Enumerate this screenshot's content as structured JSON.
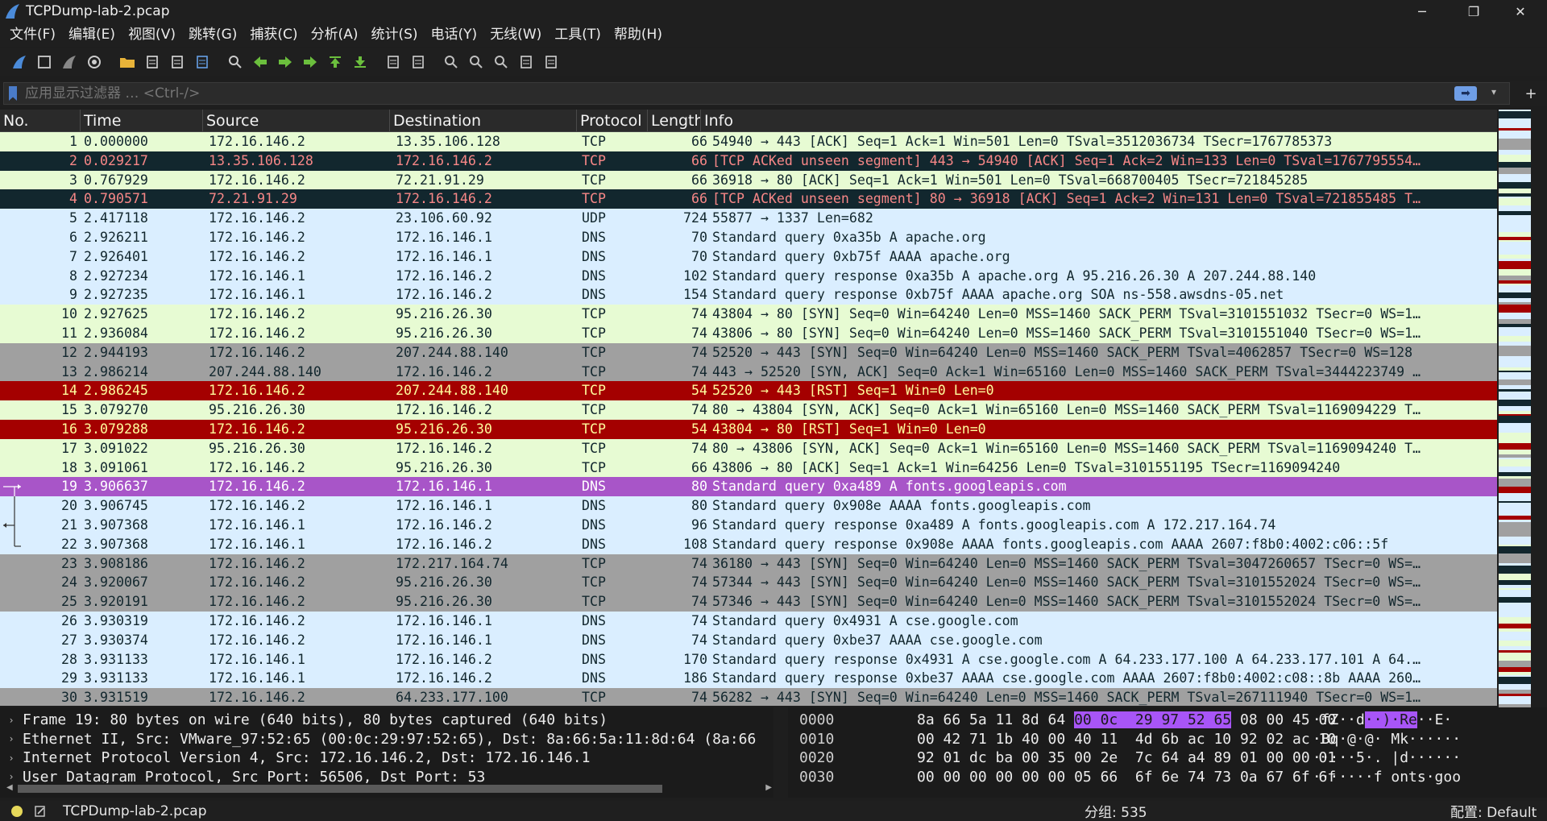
{
  "window": {
    "title": "TCPDump-lab-2.pcap",
    "minimize": "─",
    "restore": "❐",
    "close": "✕"
  },
  "menu": [
    "文件(F)",
    "编辑(E)",
    "视图(V)",
    "跳转(G)",
    "捕获(C)",
    "分析(A)",
    "统计(S)",
    "电话(Y)",
    "无线(W)",
    "工具(T)",
    "帮助(H)"
  ],
  "toolbar": {
    "icons": [
      "shark-fin-icon",
      "stop-square-icon",
      "restart-fin-icon",
      "capture-options-icon",
      "open-folder-icon",
      "file-icon",
      "close-file-icon",
      "reload-icon",
      "find-icon",
      "go-back-icon",
      "go-forward-icon",
      "go-to-packet-icon",
      "first-packet-icon",
      "last-packet-icon",
      "autoscroll-icon",
      "colorize-icon",
      "zoom-in-icon",
      "zoom-out-icon",
      "zoom-normal-icon",
      "resize-columns-icon",
      "layout-icon"
    ]
  },
  "filter": {
    "placeholder": "应用显示过滤器 … <Ctrl-/>",
    "apply": "➡",
    "dropdown": "▾",
    "add": "+"
  },
  "columns": [
    "No.",
    "Time",
    "Source",
    "Destination",
    "Protocol",
    "Length",
    "Info"
  ],
  "colors": {
    "tcp_green": "#e7fbd3",
    "dns_blue": "#daeeff",
    "syn_gray": "#a0a0a0",
    "bad_dark": "#12272e",
    "bad_fg": "#f78787",
    "rst_red": "#a40000",
    "rst_fg": "#fffc9c",
    "selected": "#a855c8",
    "udp_blue": "#daeeff"
  },
  "packets": [
    {
      "no": "1",
      "time": "0.000000",
      "src": "172.16.146.2",
      "dst": "13.35.106.128",
      "proto": "TCP",
      "len": "66",
      "info": "54940 → 443 [ACK] Seq=1 Ack=1 Win=501 Len=0 TSval=3512036734 TSecr=1767785373",
      "style": "tcp"
    },
    {
      "no": "2",
      "time": "0.029217",
      "src": "13.35.106.128",
      "dst": "172.16.146.2",
      "proto": "TCP",
      "len": "66",
      "info": "[TCP ACKed unseen segment] 443 → 54940 [ACK] Seq=1 Ack=2 Win=133 Len=0 TSval=1767795554…",
      "style": "bad"
    },
    {
      "no": "3",
      "time": "0.767929",
      "src": "172.16.146.2",
      "dst": "72.21.91.29",
      "proto": "TCP",
      "len": "66",
      "info": "36918 → 80 [ACK] Seq=1 Ack=1 Win=501 Len=0 TSval=668700405 TSecr=721845285",
      "style": "tcp"
    },
    {
      "no": "4",
      "time": "0.790571",
      "src": "72.21.91.29",
      "dst": "172.16.146.2",
      "proto": "TCP",
      "len": "66",
      "info": "[TCP ACKed unseen segment] 80 → 36918 [ACK] Seq=1 Ack=2 Win=131 Len=0 TSval=721855485 T…",
      "style": "bad"
    },
    {
      "no": "5",
      "time": "2.417118",
      "src": "172.16.146.2",
      "dst": "23.106.60.92",
      "proto": "UDP",
      "len": "724",
      "info": "55877 → 1337 Len=682",
      "style": "dns"
    },
    {
      "no": "6",
      "time": "2.926211",
      "src": "172.16.146.2",
      "dst": "172.16.146.1",
      "proto": "DNS",
      "len": "70",
      "info": "Standard query 0xa35b A apache.org",
      "style": "dns"
    },
    {
      "no": "7",
      "time": "2.926401",
      "src": "172.16.146.2",
      "dst": "172.16.146.1",
      "proto": "DNS",
      "len": "70",
      "info": "Standard query 0xb75f AAAA apache.org",
      "style": "dns"
    },
    {
      "no": "8",
      "time": "2.927234",
      "src": "172.16.146.1",
      "dst": "172.16.146.2",
      "proto": "DNS",
      "len": "102",
      "info": "Standard query response 0xa35b A apache.org A 95.216.26.30 A 207.244.88.140",
      "style": "dns"
    },
    {
      "no": "9",
      "time": "2.927235",
      "src": "172.16.146.1",
      "dst": "172.16.146.2",
      "proto": "DNS",
      "len": "154",
      "info": "Standard query response 0xb75f AAAA apache.org SOA ns-558.awsdns-05.net",
      "style": "dns"
    },
    {
      "no": "10",
      "time": "2.927625",
      "src": "172.16.146.2",
      "dst": "95.216.26.30",
      "proto": "TCP",
      "len": "74",
      "info": "43804 → 80 [SYN] Seq=0 Win=64240 Len=0 MSS=1460 SACK_PERM TSval=3101551032 TSecr=0 WS=1…",
      "style": "tcp"
    },
    {
      "no": "11",
      "time": "2.936084",
      "src": "172.16.146.2",
      "dst": "95.216.26.30",
      "proto": "TCP",
      "len": "74",
      "info": "43806 → 80 [SYN] Seq=0 Win=64240 Len=0 MSS=1460 SACK_PERM TSval=3101551040 TSecr=0 WS=1…",
      "style": "tcp"
    },
    {
      "no": "12",
      "time": "2.944193",
      "src": "172.16.146.2",
      "dst": "207.244.88.140",
      "proto": "TCP",
      "len": "74",
      "info": "52520 → 443 [SYN] Seq=0 Win=64240 Len=0 MSS=1460 SACK_PERM TSval=4062857 TSecr=0 WS=128",
      "style": "syn"
    },
    {
      "no": "13",
      "time": "2.986214",
      "src": "207.244.88.140",
      "dst": "172.16.146.2",
      "proto": "TCP",
      "len": "74",
      "info": "443 → 52520 [SYN, ACK] Seq=0 Ack=1 Win=65160 Len=0 MSS=1460 SACK_PERM TSval=3444223749 …",
      "style": "syn"
    },
    {
      "no": "14",
      "time": "2.986245",
      "src": "172.16.146.2",
      "dst": "207.244.88.140",
      "proto": "TCP",
      "len": "54",
      "info": "52520 → 443 [RST] Seq=1 Win=0 Len=0",
      "style": "rst"
    },
    {
      "no": "15",
      "time": "3.079270",
      "src": "95.216.26.30",
      "dst": "172.16.146.2",
      "proto": "TCP",
      "len": "74",
      "info": "80 → 43804 [SYN, ACK] Seq=0 Ack=1 Win=65160 Len=0 MSS=1460 SACK_PERM TSval=1169094229 T…",
      "style": "tcp"
    },
    {
      "no": "16",
      "time": "3.079288",
      "src": "172.16.146.2",
      "dst": "95.216.26.30",
      "proto": "TCP",
      "len": "54",
      "info": "43804 → 80 [RST] Seq=1 Win=0 Len=0",
      "style": "rst"
    },
    {
      "no": "17",
      "time": "3.091022",
      "src": "95.216.26.30",
      "dst": "172.16.146.2",
      "proto": "TCP",
      "len": "74",
      "info": "80 → 43806 [SYN, ACK] Seq=0 Ack=1 Win=65160 Len=0 MSS=1460 SACK_PERM TSval=1169094240 T…",
      "style": "tcp"
    },
    {
      "no": "18",
      "time": "3.091061",
      "src": "172.16.146.2",
      "dst": "95.216.26.30",
      "proto": "TCP",
      "len": "66",
      "info": "43806 → 80 [ACK] Seq=1 Ack=1 Win=64256 Len=0 TSval=3101551195 TSecr=1169094240",
      "style": "tcp"
    },
    {
      "no": "19",
      "time": "3.906637",
      "src": "172.16.146.2",
      "dst": "172.16.146.1",
      "proto": "DNS",
      "len": "80",
      "info": "Standard query 0xa489 A fonts.googleapis.com",
      "style": "selected"
    },
    {
      "no": "20",
      "time": "3.906745",
      "src": "172.16.146.2",
      "dst": "172.16.146.1",
      "proto": "DNS",
      "len": "80",
      "info": "Standard query 0x908e AAAA fonts.googleapis.com",
      "style": "dns"
    },
    {
      "no": "21",
      "time": "3.907368",
      "src": "172.16.146.1",
      "dst": "172.16.146.2",
      "proto": "DNS",
      "len": "96",
      "info": "Standard query response 0xa489 A fonts.googleapis.com A 172.217.164.74",
      "style": "dns"
    },
    {
      "no": "22",
      "time": "3.907368",
      "src": "172.16.146.1",
      "dst": "172.16.146.2",
      "proto": "DNS",
      "len": "108",
      "info": "Standard query response 0x908e AAAA fonts.googleapis.com AAAA 2607:f8b0:4002:c06::5f",
      "style": "dns"
    },
    {
      "no": "23",
      "time": "3.908186",
      "src": "172.16.146.2",
      "dst": "172.217.164.74",
      "proto": "TCP",
      "len": "74",
      "info": "36180 → 443 [SYN] Seq=0 Win=64240 Len=0 MSS=1460 SACK_PERM TSval=3047260657 TSecr=0 WS=…",
      "style": "syn"
    },
    {
      "no": "24",
      "time": "3.920067",
      "src": "172.16.146.2",
      "dst": "95.216.26.30",
      "proto": "TCP",
      "len": "74",
      "info": "57344 → 443 [SYN] Seq=0 Win=64240 Len=0 MSS=1460 SACK_PERM TSval=3101552024 TSecr=0 WS=…",
      "style": "syn"
    },
    {
      "no": "25",
      "time": "3.920191",
      "src": "172.16.146.2",
      "dst": "95.216.26.30",
      "proto": "TCP",
      "len": "74",
      "info": "57346 → 443 [SYN] Seq=0 Win=64240 Len=0 MSS=1460 SACK_PERM TSval=3101552024 TSecr=0 WS=…",
      "style": "syn"
    },
    {
      "no": "26",
      "time": "3.930319",
      "src": "172.16.146.2",
      "dst": "172.16.146.1",
      "proto": "DNS",
      "len": "74",
      "info": "Standard query 0x4931 A cse.google.com",
      "style": "dns"
    },
    {
      "no": "27",
      "time": "3.930374",
      "src": "172.16.146.2",
      "dst": "172.16.146.1",
      "proto": "DNS",
      "len": "74",
      "info": "Standard query 0xbe37 AAAA cse.google.com",
      "style": "dns"
    },
    {
      "no": "28",
      "time": "3.931133",
      "src": "172.16.146.1",
      "dst": "172.16.146.2",
      "proto": "DNS",
      "len": "170",
      "info": "Standard query response 0x4931 A cse.google.com A 64.233.177.100 A 64.233.177.101 A 64.…",
      "style": "dns"
    },
    {
      "no": "29",
      "time": "3.931133",
      "src": "172.16.146.1",
      "dst": "172.16.146.2",
      "proto": "DNS",
      "len": "186",
      "info": "Standard query response 0xbe37 AAAA cse.google.com AAAA 2607:f8b0:4002:c08::8b AAAA 260…",
      "style": "dns"
    },
    {
      "no": "30",
      "time": "3.931519",
      "src": "172.16.146.2",
      "dst": "64.233.177.100",
      "proto": "TCP",
      "len": "74",
      "info": "56282 → 443 [SYN] Seq=0 Win=64240 Len=0 MSS=1460 SACK_PERM TSval=267111940 TSecr=0 WS=1…",
      "style": "syn"
    }
  ],
  "details": [
    {
      "expander": "›",
      "text": "Frame 19: 80 bytes on wire (640 bits), 80 bytes captured (640 bits)"
    },
    {
      "expander": "›",
      "text": "Ethernet II, Src: VMware_97:52:65 (00:0c:29:97:52:65), Dst: 8a:66:5a:11:8d:64 (8a:66"
    },
    {
      "expander": "›",
      "text": "Internet Protocol Version 4, Src: 172.16.146.2, Dst: 172.16.146.1"
    },
    {
      "expander": "›",
      "text": "User Datagram Protocol, Src Port: 56506, Dst Port: 53"
    }
  ],
  "bytes": [
    {
      "off": "0000",
      "pre": "8a 66 5a 11 8d 64 ",
      "hl": "00 0c  29 97 52 65",
      "post": " 08 00 45 00",
      "asc_pre": " ·fZ··d",
      "asc_hl": "··)·Re",
      "asc_post": "··E·"
    },
    {
      "off": "0010",
      "pre": "00 42 71 1b 40 00 40 11  4d 6b ac 10 92 02 ac 10",
      "hl": "",
      "post": "",
      "asc_pre": " ·Bq·@·@· Mk······",
      "asc_hl": "",
      "asc_post": ""
    },
    {
      "off": "0020",
      "pre": "92 01 dc ba 00 35 00 2e  7c 64 a4 89 01 00 00 01",
      "hl": "",
      "post": "",
      "asc_pre": " ·····5·. |d······",
      "asc_hl": "",
      "asc_post": ""
    },
    {
      "off": "0030",
      "pre": "00 00 00 00 00 00 05 66  6f 6e 74 73 0a 67 6f 6f",
      "hl": "",
      "post": "",
      "asc_pre": " ·······f onts·goo",
      "asc_hl": "",
      "asc_post": ""
    }
  ],
  "status": {
    "file": "TCPDump-lab-2.pcap",
    "packets": "分组: 535",
    "profile": "配置: Default"
  }
}
